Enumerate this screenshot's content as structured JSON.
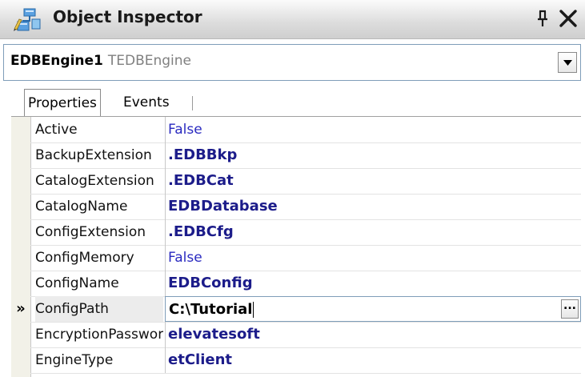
{
  "window": {
    "title": "Object Inspector",
    "title_icon": "object-inspector-icon",
    "pin_icon": "pin-icon",
    "close_icon": "close-icon"
  },
  "component": {
    "name": "EDBEngine1",
    "type": "TEDBEngine"
  },
  "tabs": {
    "properties": "Properties",
    "events": "Events"
  },
  "properties": [
    {
      "name": "Active",
      "value": "False",
      "modified": false
    },
    {
      "name": "BackupExtension",
      "value": ".EDBBkp",
      "modified": true
    },
    {
      "name": "CatalogExtension",
      "value": ".EDBCat",
      "modified": true
    },
    {
      "name": "CatalogName",
      "value": "EDBDatabase",
      "modified": true
    },
    {
      "name": "ConfigExtension",
      "value": ".EDBCfg",
      "modified": true
    },
    {
      "name": "ConfigMemory",
      "value": "False",
      "modified": false
    },
    {
      "name": "ConfigName",
      "value": "EDBConfig",
      "modified": true
    },
    {
      "name": "ConfigPath",
      "value": "C:\\Tutorial",
      "modified": true,
      "selected": true
    },
    {
      "name": "EncryptionPassword",
      "value": "elevatesoft",
      "modified": true
    },
    {
      "name": "EngineType",
      "value": "etClient",
      "modified": true
    }
  ],
  "selection_marker": "»",
  "ellipsis_label": "...",
  "colors": {
    "modified_value": "#1c1c8a",
    "default_value": "#2a2ac0",
    "gutter": "#f2f1e8"
  }
}
